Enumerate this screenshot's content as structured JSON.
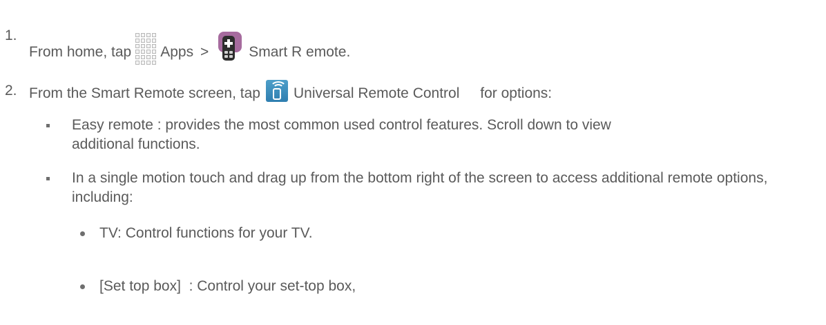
{
  "steps": [
    {
      "number": "1.",
      "text_before": "From home, tap",
      "apps_label": "Apps",
      "separator": ">",
      "app_label": "Smart R emote",
      "end": "."
    },
    {
      "number": "2.",
      "text_before": "From the Smart Remote screen, tap",
      "urc_label": "Universal Remote Control",
      "text_after": "for options:"
    }
  ],
  "bullets": [
    "Easy remote : provides the most common used control features. Scroll down to view additional functions.",
    "In a single motion touch and drag up from the bottom right of the screen to access additional remote options, including:"
  ],
  "sub_bullets": [
    "TV: Control functions for your TV.",
    "[Set top box]  : Control your set-top box,"
  ],
  "icons": {
    "apps": "apps-grid-icon",
    "smart_remote": "smart-remote-icon",
    "universal_remote": "universal-remote-control-icon"
  },
  "colors": {
    "text": "#5a5a5a",
    "smart_remote_bg": "#a66b9e",
    "urc_bg": "#3a8cbd"
  }
}
